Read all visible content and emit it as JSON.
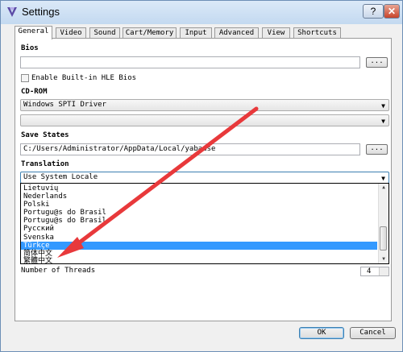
{
  "window": {
    "title": "Settings",
    "help_label": "?",
    "close_label": "✕"
  },
  "tabs": [
    {
      "label": "General"
    },
    {
      "label": "Video"
    },
    {
      "label": "Sound"
    },
    {
      "label": "Cart/Memory"
    },
    {
      "label": "Input"
    },
    {
      "label": "Advanced"
    },
    {
      "label": "View"
    },
    {
      "label": "Shortcuts"
    }
  ],
  "bios": {
    "heading": "Bios",
    "path_value": "",
    "browse_label": "...",
    "checkbox_label": "Enable Built-in HLE Bios",
    "checkbox_checked": false
  },
  "cdrom": {
    "heading": "CD-ROM",
    "driver_value": "Windows SPTI Driver",
    "drive_value": ""
  },
  "save_states": {
    "heading": "Save States",
    "path_value": "C:/Users/Administrator/AppData/Local/yabause",
    "browse_label": "..."
  },
  "translation": {
    "heading": "Translation",
    "selected_value": "Use System Locale",
    "options": [
      "Lietuvių",
      "Nederlands",
      "Polski",
      "Portugu@s do Brasil",
      "Portugu@s do Brasil",
      "Русский",
      "Svenska",
      "Türkçe",
      "简体中文",
      "繁體中文"
    ],
    "highlighted_index": 7
  },
  "threads": {
    "label": "Number of Threads",
    "value": "4"
  },
  "footer": {
    "ok_label": "OK",
    "cancel_label": "Cancel"
  },
  "colors": {
    "selection": "#3399ff",
    "annotation_arrow": "#e8393b"
  },
  "icons": {
    "app": "yabause-logo-icon",
    "combo_arrow": "chevron-down-icon"
  }
}
